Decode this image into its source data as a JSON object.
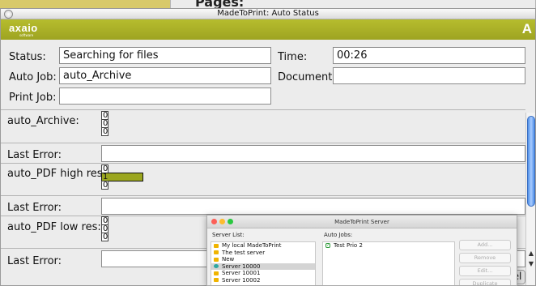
{
  "background_window": {
    "label": "Pages:"
  },
  "window": {
    "title": "MadeToPrint: Auto Status"
  },
  "brand": {
    "logo": "axaio",
    "logo_sub": "software",
    "right_logo": "A"
  },
  "status": {
    "status_label": "Status:",
    "status_value": "Searching for files",
    "time_label": "Time:",
    "time_value": "00:26",
    "autojob_label": "Auto Job:",
    "autojob_value": "auto_Archive",
    "document_label": "Document:",
    "document_value": "",
    "printjob_label": "Print Job:",
    "printjob_value": ""
  },
  "jobs": [
    {
      "name": "auto_Archive:",
      "counts": [
        "0",
        "0",
        "0"
      ],
      "error_label": "Last Error:",
      "error_value": ""
    },
    {
      "name": "auto_PDF high res:",
      "counts": [
        "0",
        "1",
        "0"
      ],
      "error_label": "Last Error:",
      "error_value": ""
    },
    {
      "name": "auto_PDF low res:",
      "counts": [
        "0",
        "0",
        "0"
      ],
      "error_label": "Last Error:",
      "error_value": ""
    }
  ],
  "bottom_fragment": "el",
  "server_window": {
    "title": "MadeToPrint Server",
    "server_list_label": "Server List:",
    "auto_jobs_label": "Auto Jobs:",
    "servers": [
      {
        "name": "My local MadeToPrint",
        "color": "#f0b400"
      },
      {
        "name": "The test server",
        "color": "#f0b400"
      },
      {
        "name": "New",
        "color": "#f0b400"
      },
      {
        "name": "Server 10000",
        "color": "#2fa7a0"
      },
      {
        "name": "Server 10001",
        "color": "#f0b400"
      },
      {
        "name": "Server 10002",
        "color": "#f0b400"
      }
    ],
    "auto_jobs": [
      "Test Prio 2"
    ],
    "buttons": {
      "add": "Add...",
      "remove": "Remove",
      "edit": "Edit...",
      "duplicate": "Duplicate"
    }
  },
  "colors": {
    "accent": "#a6ad26",
    "active_count": "#9ba61f",
    "scroll_thumb": "#5b99ee"
  }
}
